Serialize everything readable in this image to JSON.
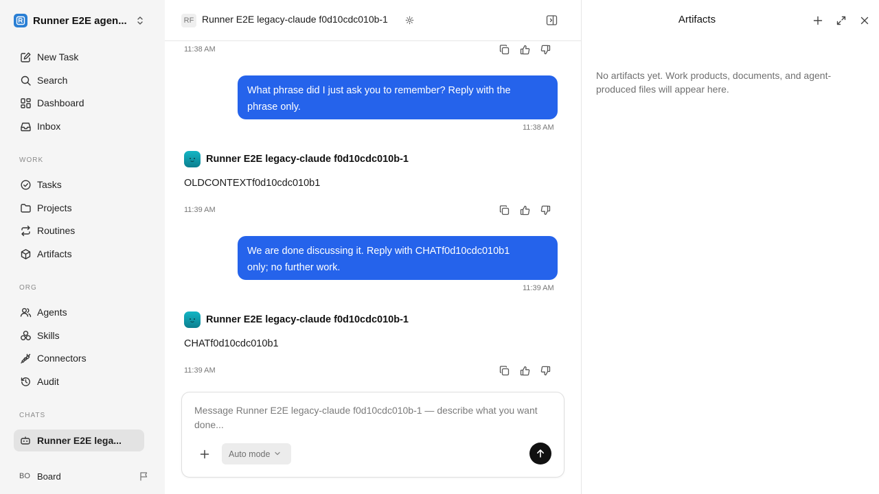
{
  "workspace": {
    "name": "Runner E2E agen..."
  },
  "nav": {
    "primary": [
      {
        "id": "new-task",
        "label": "New Task",
        "icon": "edit-icon"
      },
      {
        "id": "search",
        "label": "Search",
        "icon": "search-icon"
      },
      {
        "id": "dashboard",
        "label": "Dashboard",
        "icon": "dashboard-icon"
      },
      {
        "id": "inbox",
        "label": "Inbox",
        "icon": "inbox-icon"
      }
    ],
    "work_title": "WORK",
    "work": [
      {
        "id": "tasks",
        "label": "Tasks",
        "icon": "check-circle-icon"
      },
      {
        "id": "projects",
        "label": "Projects",
        "icon": "folder-icon"
      },
      {
        "id": "routines",
        "label": "Routines",
        "icon": "repeat-icon"
      },
      {
        "id": "artifacts",
        "label": "Artifacts",
        "icon": "cube-icon"
      }
    ],
    "org_title": "ORG",
    "org": [
      {
        "id": "agents",
        "label": "Agents",
        "icon": "users-icon"
      },
      {
        "id": "skills",
        "label": "Skills",
        "icon": "skills-icon"
      },
      {
        "id": "connectors",
        "label": "Connectors",
        "icon": "plug-icon"
      },
      {
        "id": "audit",
        "label": "Audit",
        "icon": "history-icon"
      }
    ],
    "chats_title": "CHATS",
    "chats": [
      {
        "id": "chat-runner",
        "label": "Runner E2E lega...",
        "icon": "bot-icon"
      }
    ]
  },
  "user": {
    "initials": "BO",
    "name": "Board"
  },
  "header": {
    "avatar_initials": "RF",
    "title": "Runner E2E legacy-claude f0d10cdc010b-1"
  },
  "messages": [
    {
      "type": "timestamp",
      "time": "11:38 AM"
    },
    {
      "type": "user",
      "text_line1": "What phrase did I just ask you to remember? Reply with the",
      "text_line2": "phrase only.",
      "time": "11:38 AM"
    },
    {
      "type": "agent",
      "name": "Runner E2E legacy-claude f0d10cdc010b-1",
      "text": "OLDCONTEXTf0d10cdc010b1",
      "time": "11:39 AM"
    },
    {
      "type": "user",
      "text_line1": "We are done discussing it. Reply with CHATf0d10cdc010b1",
      "text_line2": "only; no further work.",
      "time": "11:39 AM"
    },
    {
      "type": "agent",
      "name": "Runner E2E legacy-claude f0d10cdc010b-1",
      "text": "CHATf0d10cdc010b1",
      "time": "11:39 AM"
    }
  ],
  "composer": {
    "placeholder": "Message Runner E2E legacy-claude f0d10cdc010b-1 — describe what you want done...",
    "mode_label": "Auto mode"
  },
  "artifacts": {
    "title": "Artifacts",
    "empty_text": "No artifacts yet. Work products, documents, and agent-produced files will appear here."
  },
  "colors": {
    "accent": "#2563eb",
    "sidebar_bg": "#f5f5f5",
    "active_chat_bg": "#e3e3e3",
    "send_button": "#111111"
  }
}
